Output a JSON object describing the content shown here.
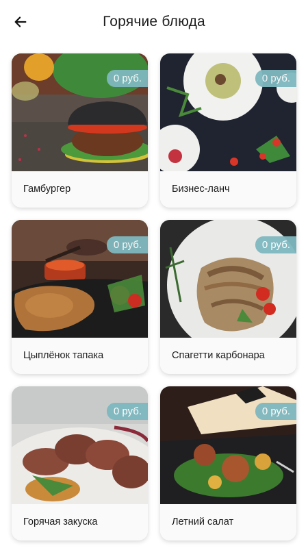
{
  "header": {
    "title": "Горячие блюда",
    "back_icon": "arrow-left-icon"
  },
  "colors": {
    "price_badge": "#7fb8bf",
    "card_footer": "#fafafa"
  },
  "dishes": [
    {
      "name": "Гамбургер",
      "price": "0 руб.",
      "image": "burger-photo"
    },
    {
      "name": "Бизнес-ланч",
      "price": "0 руб.",
      "image": "business-lunch-photo"
    },
    {
      "name": "Цыплёнок тапака",
      "price": "0 руб.",
      "image": "chicken-tapaka-photo"
    },
    {
      "name": "Спагетти карбонара",
      "price": "0 руб.",
      "image": "spaghetti-carbonara-photo"
    },
    {
      "name": "Горячая закуска",
      "price": "0 руб.",
      "image": "hot-appetizer-photo"
    },
    {
      "name": "Летний салат",
      "price": "0 руб.",
      "image": "summer-salad-photo"
    }
  ]
}
